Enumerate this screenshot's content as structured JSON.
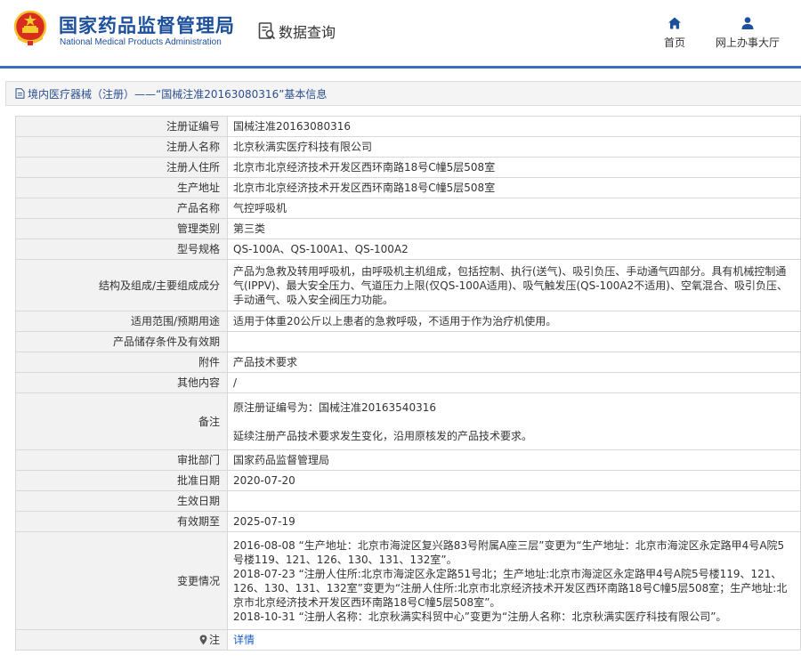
{
  "header": {
    "title_cn": "国家药品监督管理局",
    "title_en": "National Medical Products Administration",
    "query_label": "数据查询",
    "emblem_icon": "national-emblem-icon",
    "query_icon": "data-query-icon",
    "nav": [
      {
        "label": "首页",
        "icon": "home-icon"
      },
      {
        "label": "网上办事大厅",
        "icon": "user-icon"
      }
    ]
  },
  "breadcrumb": {
    "text": "境内医疗器械（注册）——“国械注准20163080316”基本信息",
    "icon": "document-icon"
  },
  "fields": {
    "reg_no": {
      "label": "注册证编号",
      "value": "国械注准20163080316"
    },
    "registrant_name": {
      "label": "注册人名称",
      "value": "北京秋满实医疗科技有限公司"
    },
    "registrant_address": {
      "label": "注册人住所",
      "value": "北京市北京经济技术开发区西环南路18号C幢5层508室"
    },
    "production_address": {
      "label": "生产地址",
      "value": "北京市北京经济技术开发区西环南路18号C幢5层508室"
    },
    "product_name": {
      "label": "产品名称",
      "value": "气控呼吸机"
    },
    "category": {
      "label": "管理类别",
      "value": "第三类"
    },
    "model": {
      "label": "型号规格",
      "value": "QS-100A、QS-100A1、QS-100A2"
    },
    "structure": {
      "label": "结构及组成/主要组成成分",
      "value": "产品为急救及转用呼吸机，由呼吸机主机组成，包括控制、执行(送气)、吸引负压、手动通气四部分。具有机械控制通气(IPPV)、最大安全压力、气道压力上限(仅QS-100A适用)、吸气触发压(QS-100A2不适用)、空氧混合、吸引负压、手动通气、吸入安全阀压力功能。"
    },
    "scope": {
      "label": "适用范围/预期用途",
      "value": "适用于体重20公斤以上患者的急救呼吸，不适用于作为治疗机使用。"
    },
    "storage": {
      "label": "产品储存条件及有效期",
      "value": ""
    },
    "attachment": {
      "label": "附件",
      "value": "产品技术要求"
    },
    "other": {
      "label": "其他内容",
      "value": "/"
    },
    "remark": {
      "label": "备注",
      "line1": "原注册证编号为：国械注准20163540316",
      "line2": "延续注册产品技术要求发生变化，沿用原核发的产品技术要求。"
    },
    "approval_dept": {
      "label": "审批部门",
      "value": "国家药品监督管理局"
    },
    "approval_date": {
      "label": "批准日期",
      "value": "2020-07-20"
    },
    "effective_date": {
      "label": "生效日期",
      "value": ""
    },
    "expiry_date": {
      "label": "有效期至",
      "value": "2025-07-19"
    },
    "changes": {
      "label": "变更情况",
      "entries": [
        "2016-08-08 “生产地址：北京市海淀区复兴路83号附属A座三层”变更为“生产地址：北京市海淀区永定路甲4号A院5号楼119、121、126、130、131、132室”。",
        "2018-07-23 “注册人住所:北京市海淀区永定路51号北；生产地址:北京市海淀区永定路甲4号A院5号楼119、121、126、130、131、132室”变更为“注册人住所:北京市北京经济技术开发区西环南路18号C幢5层508室；生产地址:北京市北京经济技术开发区西环南路18号C幢5层508室”。",
        "2018-10-31 “注册人名称：北京秋满实科贸中心”变更为“注册人名称：北京秋满实医疗科技有限公司”。"
      ]
    },
    "detail": {
      "label": "注",
      "value": "详情",
      "icon": "map-pin-icon"
    }
  }
}
